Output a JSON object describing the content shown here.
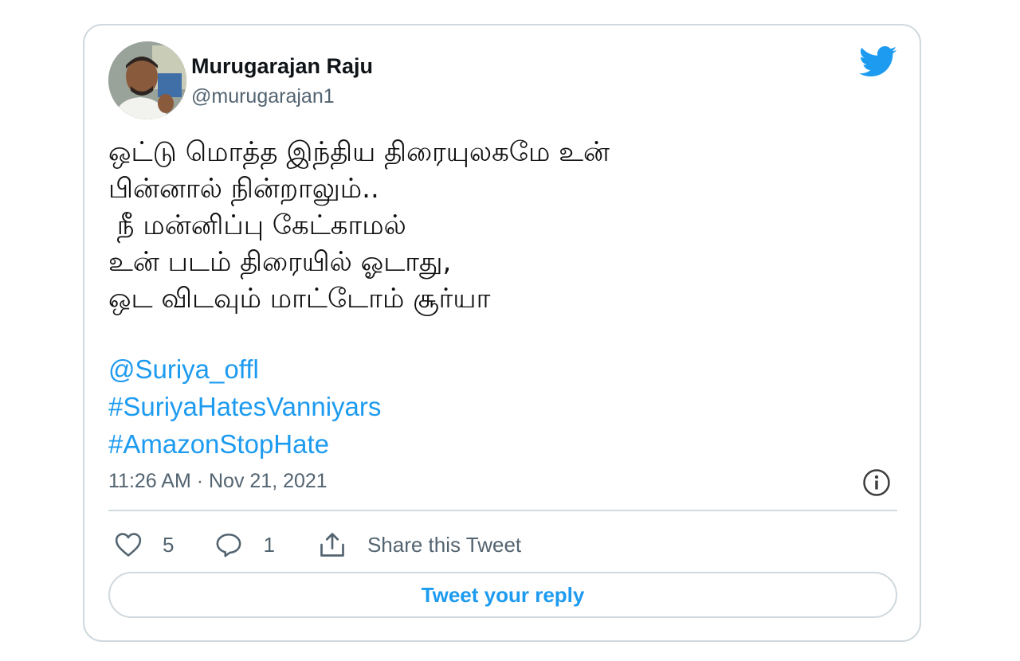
{
  "author": {
    "display_name": "Murugarajan Raju",
    "handle": "@murugarajan1"
  },
  "tweet": {
    "lines": [
      "ஒட்டு மொத்த இந்திய திரையுலகமே உன்",
      "பின்னால் நின்றாலும்..",
      " நீ மன்னிப்பு கேட்காமல்",
      "உன் படம் திரையில் ஓடாது,",
      "ஒட விடவும் மாட்டோம் சூர்யா"
    ],
    "links": [
      "@Suriya_offl",
      "#SuriyaHatesVanniyars",
      "#AmazonStopHate"
    ],
    "timestamp": "11:26 AM · Nov 21, 2021"
  },
  "actions": {
    "like_count": "5",
    "reply_count": "1",
    "share_label": "Share this Tweet"
  },
  "reply_button_label": "Tweet your reply",
  "icons": {
    "brand": "twitter-bird-icon",
    "like": "heart-icon",
    "reply": "speech-bubble-icon",
    "share": "share-upload-icon",
    "info": "info-icon"
  },
  "colors": {
    "brand_blue": "#1d9bf0",
    "secondary_text": "#536471",
    "border": "#cfd9de"
  }
}
